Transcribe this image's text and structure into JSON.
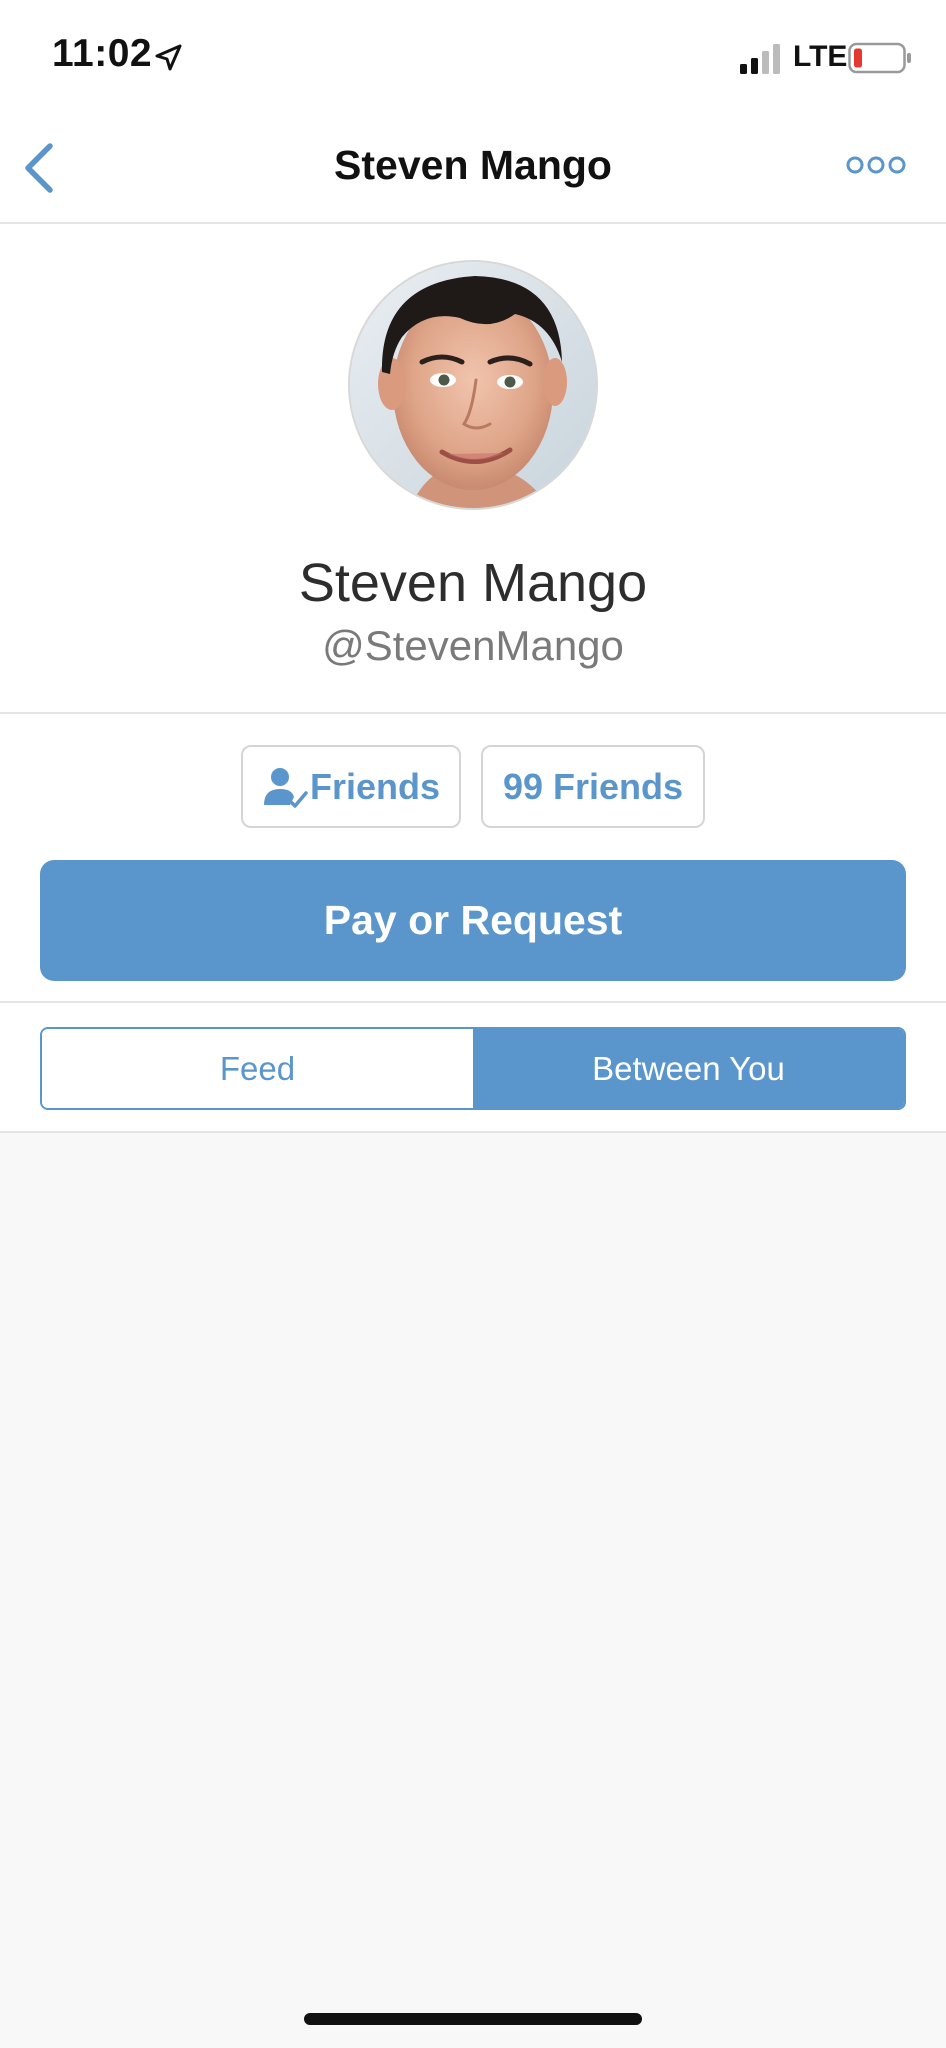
{
  "status_bar": {
    "time": "11:02",
    "network": "LTE",
    "icons": [
      "location-arrow-icon",
      "signal-bars-icon",
      "battery-low-icon"
    ]
  },
  "nav": {
    "title": "Steven Mango",
    "back_icon": "chevron-left-icon",
    "more_icon": "more-dots-icon"
  },
  "profile": {
    "name": "Steven Mango",
    "handle": "@StevenMango",
    "avatar": "profile-photo"
  },
  "actions": {
    "friends_label": "Friends",
    "friends_icon": "friend-check-icon",
    "friend_count_label": "99 Friends",
    "pay_label": "Pay or Request"
  },
  "tabs": {
    "items": [
      {
        "label": "Feed",
        "selected": false
      },
      {
        "label": "Between You",
        "selected": true
      }
    ]
  },
  "colors": {
    "accent": "#5a95cb",
    "background": "#f8f8f8",
    "battery_low": "#e5392f"
  }
}
